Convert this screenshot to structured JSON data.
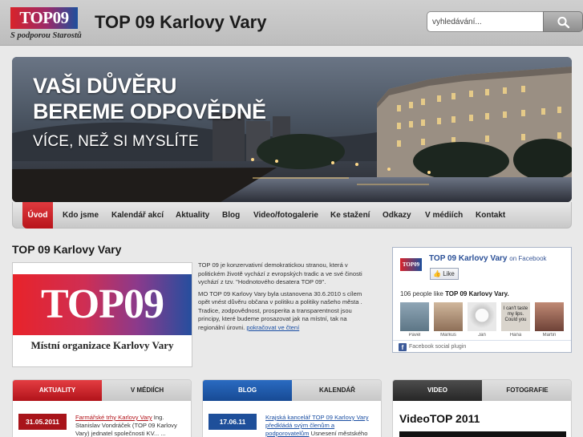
{
  "header": {
    "logo_text": "TOP09",
    "logo_tagline": "S podporou Starostů",
    "site_title": "TOP 09 Karlovy Vary",
    "search_placeholder": "vyhledávání..."
  },
  "banner": {
    "headline_line1": "VAŠI DŮVĚRU",
    "headline_line2": "BEREME ODPOVĚDNĚ",
    "subline": "VÍCE, NEŽ SI MYSLÍTE"
  },
  "nav": {
    "items": [
      {
        "label": "Úvod",
        "active": true
      },
      {
        "label": "Kdo jsme"
      },
      {
        "label": "Kalendář akcí"
      },
      {
        "label": "Aktuality"
      },
      {
        "label": "Blog"
      },
      {
        "label": "Video/fotogalerie"
      },
      {
        "label": "Ke stažení"
      },
      {
        "label": "Odkazy"
      },
      {
        "label": "V médiích"
      },
      {
        "label": "Kontakt"
      }
    ]
  },
  "main": {
    "title": "TOP 09 Karlovy Vary",
    "org_logo": "TOP09",
    "org_caption": "Místní organizace Karlovy Vary",
    "intro_p1": "TOP 09 je konzervativní demokratickou stranou, která v politickém životě vychází z evropských tradic a ve své činosti vychází z tzv. \"Hodnotového desatera TOP 09\".",
    "intro_p2": "MO TOP 09 Karlovy Vary byla ustanovena 30.6.2010 s cílem opět vnést důvěru občana v politiku a politiky našeho města . Tradice, zodpovědnost, prosperita a transparentnost jsou principy, které budeme prosazovat jak na místní, tak na regionální úrovni.",
    "intro_link": "pokračovat ve čtení"
  },
  "facebook": {
    "logo": "TOP09",
    "page_name": "TOP 09 Karlovy Vary",
    "on_facebook": "on Facebook",
    "like_label": "Like",
    "count_text": "106 people like",
    "count_name": "TOP 09 Karlovy Vary.",
    "faces": [
      {
        "name": "Pavel",
        "color": "#6f8a9b"
      },
      {
        "name": "Markus",
        "color": "#b59a83"
      },
      {
        "name": "Jan",
        "color": "#d8d8d8"
      },
      {
        "name": "Hana",
        "color": "#c7c0b5"
      },
      {
        "name": "Martin",
        "color": "#9a6b5c"
      }
    ],
    "face_caption": "I can't taste my lips. Could you",
    "footer": "Facebook social plugin",
    "footer_icon": "f"
  },
  "box_news": {
    "tab_active": "AKTUALITY",
    "tab_other": "V MÉDIÍCH",
    "date": "31.05.2011",
    "link": "Farmářské trhy Karlovy Vary",
    "text": "Ing. Stanislav Vondráček (TOP 09 Karlovy Vary) jednatel společnosti KV... ..."
  },
  "box_blog": {
    "tab_active": "BLOG",
    "tab_other": "KALENDÁŘ",
    "date": "17.06.11",
    "link": "Krajská kancelář TOP 09 Karlovy Vary předkládá svým členům a podporovatelům",
    "text": "Usnesení městského"
  },
  "box_video": {
    "tab_active": "VIDEO",
    "tab_other": "FOTOGRAFIE",
    "title": "VideoTOP 2011"
  },
  "colors": {
    "brand_red": "#d8232a",
    "brand_blue": "#1d4f9c",
    "link_blue": "#1b4fa3"
  }
}
